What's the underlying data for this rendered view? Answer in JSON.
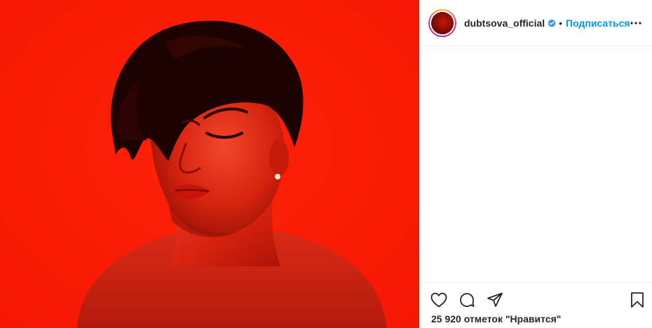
{
  "post": {
    "username": "dubtsova_official",
    "separator": "•",
    "follow_label": "Подписаться",
    "likes_text": "25 920 отметок \"Нравится\""
  },
  "icons": {
    "verified": "verified-badge-icon",
    "more": "more-options-icon",
    "like": "heart-icon",
    "comment": "comment-icon",
    "share": "share-icon",
    "save": "bookmark-icon"
  },
  "colors": {
    "photo_background": "#ff1a06",
    "link_blue": "#0095f6",
    "text": "#262626"
  }
}
